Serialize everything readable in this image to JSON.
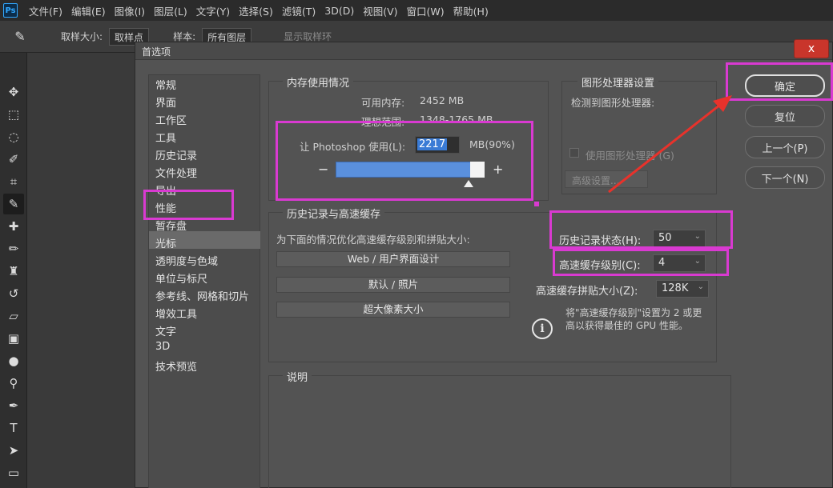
{
  "app": {
    "logo": "Ps",
    "menu": [
      "文件(F)",
      "编辑(E)",
      "图像(I)",
      "图层(L)",
      "文字(Y)",
      "选择(S)",
      "滤镜(T)",
      "3D(D)",
      "视图(V)",
      "窗口(W)",
      "帮助(H)"
    ]
  },
  "options_bar": {
    "sample_size_label": "取样大小:",
    "sample_size_value": "取样点",
    "sample_label": "样本:",
    "sample_value": "所有图层",
    "show_ring_label": "显示取样环"
  },
  "tools": [
    "move-icon",
    "marquee-icon",
    "lasso-icon",
    "quick-select-icon",
    "crop-icon",
    "eyedropper-icon",
    "healing-icon",
    "brush-icon",
    "stamp-icon",
    "history-brush-icon",
    "eraser-icon",
    "gradient-icon",
    "blur-icon",
    "dodge-icon",
    "pen-icon",
    "type-icon",
    "path-select-icon",
    "shape-icon"
  ],
  "dialog": {
    "title": "首选项",
    "close_label": "x",
    "sidebar": [
      "常规",
      "界面",
      "工作区",
      "工具",
      "历史记录",
      "文件处理",
      "导出",
      "性能",
      "暂存盘",
      "光标",
      "透明度与色域",
      "单位与标尺",
      "参考线、网格和切片",
      "增效工具",
      "文字",
      "3D",
      "技术预览"
    ],
    "selected_index": 7,
    "memory": {
      "title": "内存使用情况",
      "available_label": "可用内存:",
      "available_value": "2452 MB",
      "ideal_label": "理想范围:",
      "ideal_value": "1348-1765 MB",
      "let_label": "让 Photoshop 使用(L):",
      "input_value": "2217",
      "unit_percent": "MB(90%)",
      "minus": "−",
      "plus": "+",
      "usage_fraction": 0.9
    },
    "gpu": {
      "title": "图形处理器设置",
      "detected_label": "检测到图形处理器:",
      "use_gpu_label": "使用图形处理器 (G)",
      "advanced_label": "高级设置..."
    },
    "history_cache": {
      "title": "历史记录与高速缓存",
      "optimize_label": "为下面的情况优化高速缓存级别和拼贴大小:",
      "options": [
        "Web / 用户界面设计",
        "默认 / 照片",
        "超大像素大小"
      ],
      "history_states_label": "历史记录状态(H):",
      "history_states_value": "50",
      "cache_levels_label": "高速缓存级别(C):",
      "cache_levels_value": "4",
      "tile_size_label": "高速缓存拼贴大小(Z):",
      "tile_size_value": "128K",
      "info_line1": "将\"高速缓存级别\"设置为 2 或更",
      "info_line2": "高以获得最佳的 GPU 性能。",
      "info_icon": "i"
    },
    "description": {
      "title": "说明"
    },
    "buttons": [
      "确定",
      "复位",
      "上一个(P)",
      "下一个(N)"
    ]
  },
  "colors": {
    "highlight": "#d93ad1",
    "arrow": "#e8322b",
    "slider": "#5a90dd"
  }
}
